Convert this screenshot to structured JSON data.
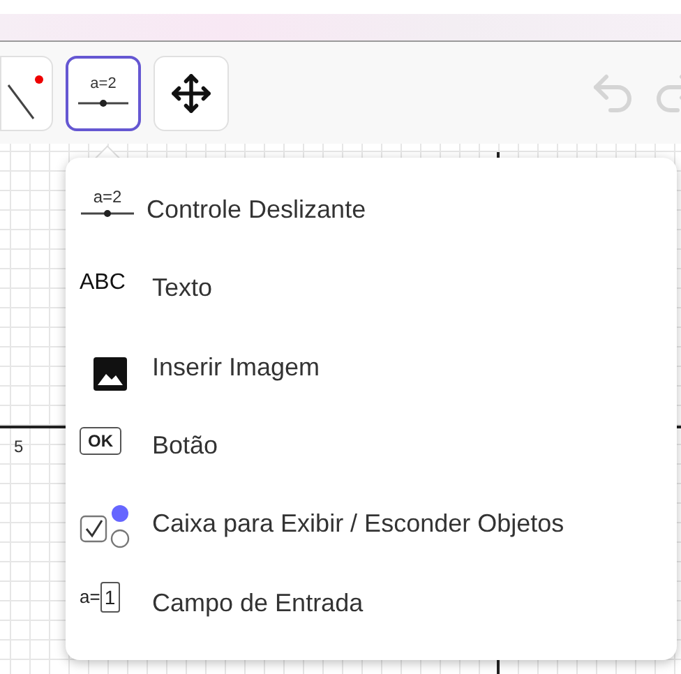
{
  "toolbar": {
    "tools": [
      {
        "kind": "line",
        "selected": false
      },
      {
        "kind": "slider",
        "label": "a=2",
        "selected": true
      },
      {
        "kind": "move",
        "selected": false
      }
    ]
  },
  "graph": {
    "axis_labels": [
      "5"
    ]
  },
  "menu": {
    "items": [
      {
        "kind": "slider",
        "icon_text": "a=2",
        "label": "Controle Deslizante"
      },
      {
        "kind": "text",
        "icon_text": "ABC",
        "label": "Texto"
      },
      {
        "kind": "image",
        "label": "Inserir Imagem"
      },
      {
        "kind": "button",
        "icon_text": "OK",
        "label": "Botão"
      },
      {
        "kind": "checkbox",
        "label": "Caixa para Exibir / Esconder Objetos"
      },
      {
        "kind": "input",
        "icon_text": "a=",
        "icon_value": "1",
        "label": "Campo de Entrada"
      }
    ]
  }
}
